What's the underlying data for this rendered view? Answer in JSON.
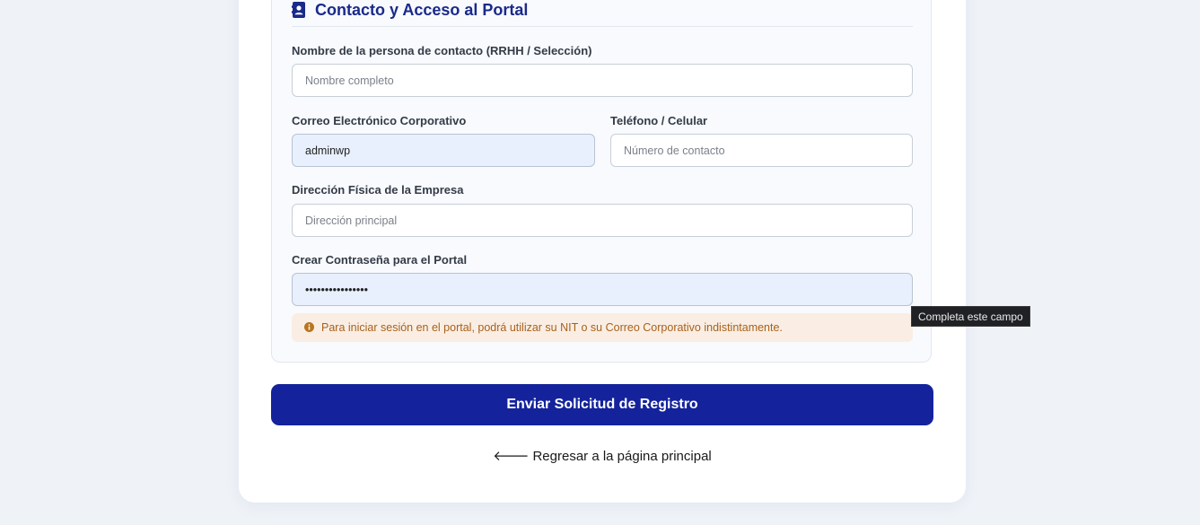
{
  "section": {
    "title": "Contacto y Acceso al Portal",
    "icon": "contact-card-icon"
  },
  "fields": {
    "contact_name": {
      "label": "Nombre de la persona de contacto (RRHH / Selección)",
      "placeholder": "Nombre completo",
      "value": ""
    },
    "email": {
      "label": "Correo Electrónico Corporativo",
      "placeholder": "",
      "value": "adminwp"
    },
    "phone": {
      "label": "Teléfono / Celular",
      "placeholder": "Número de contacto",
      "value": ""
    },
    "address": {
      "label": "Dirección Física de la Empresa",
      "placeholder": "Dirección principal",
      "value": ""
    },
    "password": {
      "label": "Crear Contraseña para el Portal",
      "placeholder": "",
      "value": "••••••••••••••••"
    }
  },
  "hint": {
    "icon": "info-circle-icon",
    "text": "Para iniciar sesión en el portal, podrá utilizar su NIT o su Correo Corporativo indistintamente."
  },
  "submit_label": "Enviar Solicitud de Registro",
  "back_link": {
    "icon": "arrow-left-icon",
    "arrow": "🡐",
    "label": "Regresar a la página principal"
  },
  "tooltip": "Completa este campo",
  "colors": {
    "accent": "#14239c",
    "title": "#1a2a8a",
    "hint_bg": "#faeee4",
    "hint_text": "#a8611a",
    "autofill_bg": "#e8f0fe",
    "page_bg": "#eff3f8"
  }
}
